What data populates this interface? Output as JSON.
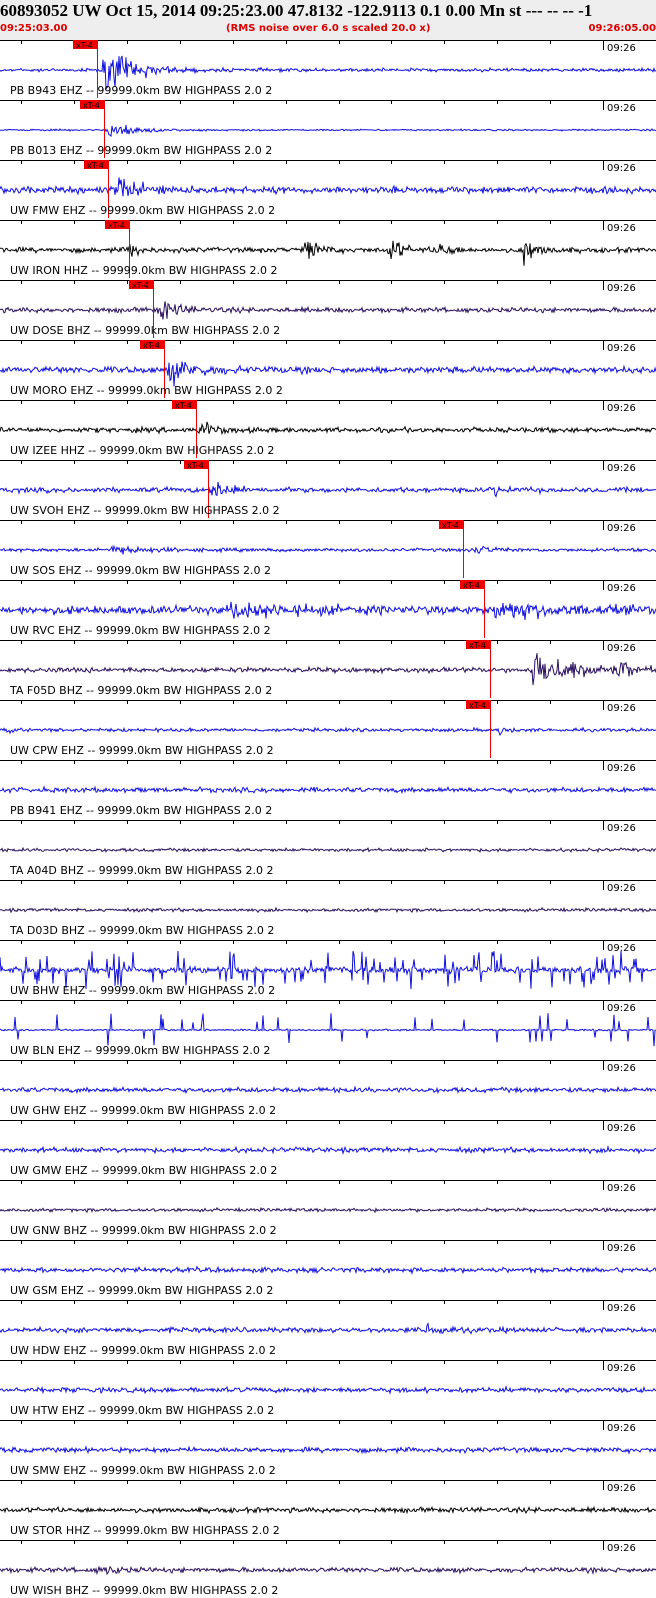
{
  "header": {
    "title": "60893052 UW Oct 15, 2014 09:25:23.00   47.8132 -122.9113  0.1 0.00 Mn st --- -- --  -1",
    "start_time": "09:25:03.00",
    "end_time": "09:26:05.00",
    "note": "(RMS noise over 6.0 s scaled 20.0 x)"
  },
  "colors": {
    "blue": "#1010dd",
    "navy": "#2a1060",
    "black": "#000000",
    "pick": "#ee0000",
    "header_bg": "#eeeeee",
    "header_red": "#dd0000"
  },
  "chart_data": {
    "type": "line",
    "x_range": [
      "09:25:03.00",
      "09:26:05.00"
    ],
    "minute_mark_label": "09:26",
    "pick_label": "xT-4",
    "filter": "99999.0km BW  HIGHPASS  2.0  2",
    "traces": [
      {
        "label": "PB B943 EHZ -- 99999.0km BW  HIGHPASS  2.0  2",
        "color": "blue",
        "pick_s": 9.2,
        "amp": 2,
        "events": [
          {
            "t": 10.0,
            "amp": 26,
            "width": 2.5
          }
        ]
      },
      {
        "label": "PB B013 EHZ -- 99999.0km BW  HIGHPASS  2.0  2",
        "color": "blue",
        "pick_s": 9.8,
        "amp": 1,
        "events": [
          {
            "t": 10.5,
            "amp": 12,
            "width": 2.0
          }
        ]
      },
      {
        "label": "UW FMW EHZ -- 99999.0km BW  HIGHPASS  2.0  2",
        "color": "blue",
        "pick_s": 10.2,
        "amp": 4,
        "events": [
          {
            "t": 11.0,
            "amp": 14,
            "width": 2.2
          }
        ]
      },
      {
        "label": "UW IRON HHZ -- 99999.0km BW  HIGHPASS  2.0  2",
        "color": "black",
        "pick_s": 12.2,
        "amp": 3,
        "events": [
          {
            "t": 12.5,
            "amp": 12,
            "width": 0.5
          },
          {
            "t": 29.0,
            "amp": 14,
            "width": 1.0
          },
          {
            "t": 37.0,
            "amp": 16,
            "width": 0.9
          },
          {
            "t": 41.5,
            "amp": 10,
            "width": 0.9
          },
          {
            "t": 49.5,
            "amp": 14,
            "width": 1.2
          }
        ]
      },
      {
        "label": "UW DOSE BHZ -- 99999.0km BW  HIGHPASS  2.0  2",
        "color": "navy",
        "pick_s": 14.5,
        "amp": 3,
        "events": [
          {
            "t": 15.2,
            "amp": 12,
            "width": 1.6
          }
        ]
      },
      {
        "label": "UW MORO EHZ -- 99999.0km BW  HIGHPASS  2.0  2",
        "color": "blue",
        "pick_s": 15.5,
        "amp": 4,
        "events": [
          {
            "t": 16.2,
            "amp": 14,
            "width": 2.2
          }
        ]
      },
      {
        "label": "UW IZEE HHZ -- 99999.0km BW  HIGHPASS  2.0  2",
        "color": "black",
        "pick_s": 18.5,
        "amp": 3,
        "events": [
          {
            "t": 19.2,
            "amp": 10,
            "width": 1.2
          }
        ]
      },
      {
        "label": "UW SVOH EHZ -- 99999.0km BW  HIGHPASS  2.0  2",
        "color": "blue",
        "pick_s": 19.7,
        "amp": 3,
        "events": [
          {
            "t": 20.2,
            "amp": 14,
            "width": 1.2
          },
          {
            "t": 46.5,
            "amp": 6,
            "width": 1.0
          }
        ]
      },
      {
        "label": "UW SOS EHZ -- 99999.0km BW  HIGHPASS  2.0  2",
        "color": "blue",
        "pick_s": 43.8,
        "amp": 2,
        "events": [
          {
            "t": 10.5,
            "amp": 5,
            "width": 3.0
          },
          {
            "t": 45.0,
            "amp": 5,
            "width": 1.5
          }
        ]
      },
      {
        "label": "UW RVC EHZ -- 99999.0km BW  HIGHPASS  2.0  2",
        "color": "blue",
        "pick_s": 45.7,
        "amp": 5,
        "events": [
          {
            "t": 22.0,
            "amp": 8,
            "width": 5.0
          },
          {
            "t": 47.0,
            "amp": 10,
            "width": 5.0
          }
        ]
      },
      {
        "label": "TA F05D BHZ -- 99999.0km BW  HIGHPASS  2.0  2",
        "color": "navy",
        "pick_s": 46.3,
        "amp": 3,
        "events": [
          {
            "t": 50.5,
            "amp": 20,
            "width": 4.5
          },
          {
            "t": 58.8,
            "amp": 14,
            "width": 0.4
          }
        ]
      },
      {
        "label": "UW CPW EHZ -- 99999.0km BW  HIGHPASS  2.0  2",
        "color": "blue",
        "pick_s": 46.3,
        "amp": 2,
        "events": [
          {
            "t": 0.8,
            "amp": 7,
            "width": 0.3
          },
          {
            "t": 47.5,
            "amp": 10,
            "width": 0.4
          }
        ]
      },
      {
        "label": "PB B941 EHZ -- 99999.0km BW  HIGHPASS  2.0  2",
        "color": "blue",
        "amp": 3,
        "events": []
      },
      {
        "label": "TA A04D BHZ -- 99999.0km BW  HIGHPASS  2.0  2",
        "color": "navy",
        "amp": 2,
        "events": []
      },
      {
        "label": "TA D03D BHZ -- 99999.0km BW  HIGHPASS  2.0  2",
        "color": "navy",
        "amp": 2,
        "events": []
      },
      {
        "label": "UW BHW EHZ -- 99999.0km BW  HIGHPASS  2.0  2",
        "color": "blue",
        "amp": 4,
        "spikes": 95,
        "spike_amp": 16,
        "events": []
      },
      {
        "label": "UW BLN EHZ -- 99999.0km BW  HIGHPASS  2.0  2",
        "color": "blue",
        "amp": 1,
        "spikes": 26,
        "spike_amp": 14,
        "events": []
      },
      {
        "label": "UW GHW EHZ -- 99999.0km BW  HIGHPASS  2.0  2",
        "color": "blue",
        "amp": 3,
        "events": []
      },
      {
        "label": "UW GMW EHZ -- 99999.0km BW  HIGHPASS  2.0  2",
        "color": "blue",
        "amp": 3,
        "events": []
      },
      {
        "label": "UW GNW BHZ -- 99999.0km BW  HIGHPASS  2.0  2",
        "color": "navy",
        "amp": 2,
        "events": []
      },
      {
        "label": "UW GSM EHZ -- 99999.0km BW  HIGHPASS  2.0  2",
        "color": "blue",
        "amp": 3,
        "events": []
      },
      {
        "label": "UW HDW EHZ -- 99999.0km BW  HIGHPASS  2.0  2",
        "color": "blue",
        "amp": 3,
        "events": [
          {
            "t": 40.5,
            "amp": 7,
            "width": 1.5
          }
        ]
      },
      {
        "label": "UW HTW EHZ -- 99999.0km BW  HIGHPASS  2.0  2",
        "color": "blue",
        "amp": 3,
        "events": []
      },
      {
        "label": "UW SMW EHZ -- 99999.0km BW  HIGHPASS  2.0  2",
        "color": "blue",
        "amp": 3,
        "events": []
      },
      {
        "label": "UW STOR HHZ -- 99999.0km BW  HIGHPASS  2.0  2",
        "color": "black",
        "amp": 3,
        "events": []
      },
      {
        "label": "UW WISH BHZ -- 99999.0km BW  HIGHPASS  2.0  2",
        "color": "navy",
        "amp": 3,
        "events": [
          {
            "t": 9.5,
            "amp": 5,
            "width": 1.5
          }
        ]
      }
    ]
  }
}
